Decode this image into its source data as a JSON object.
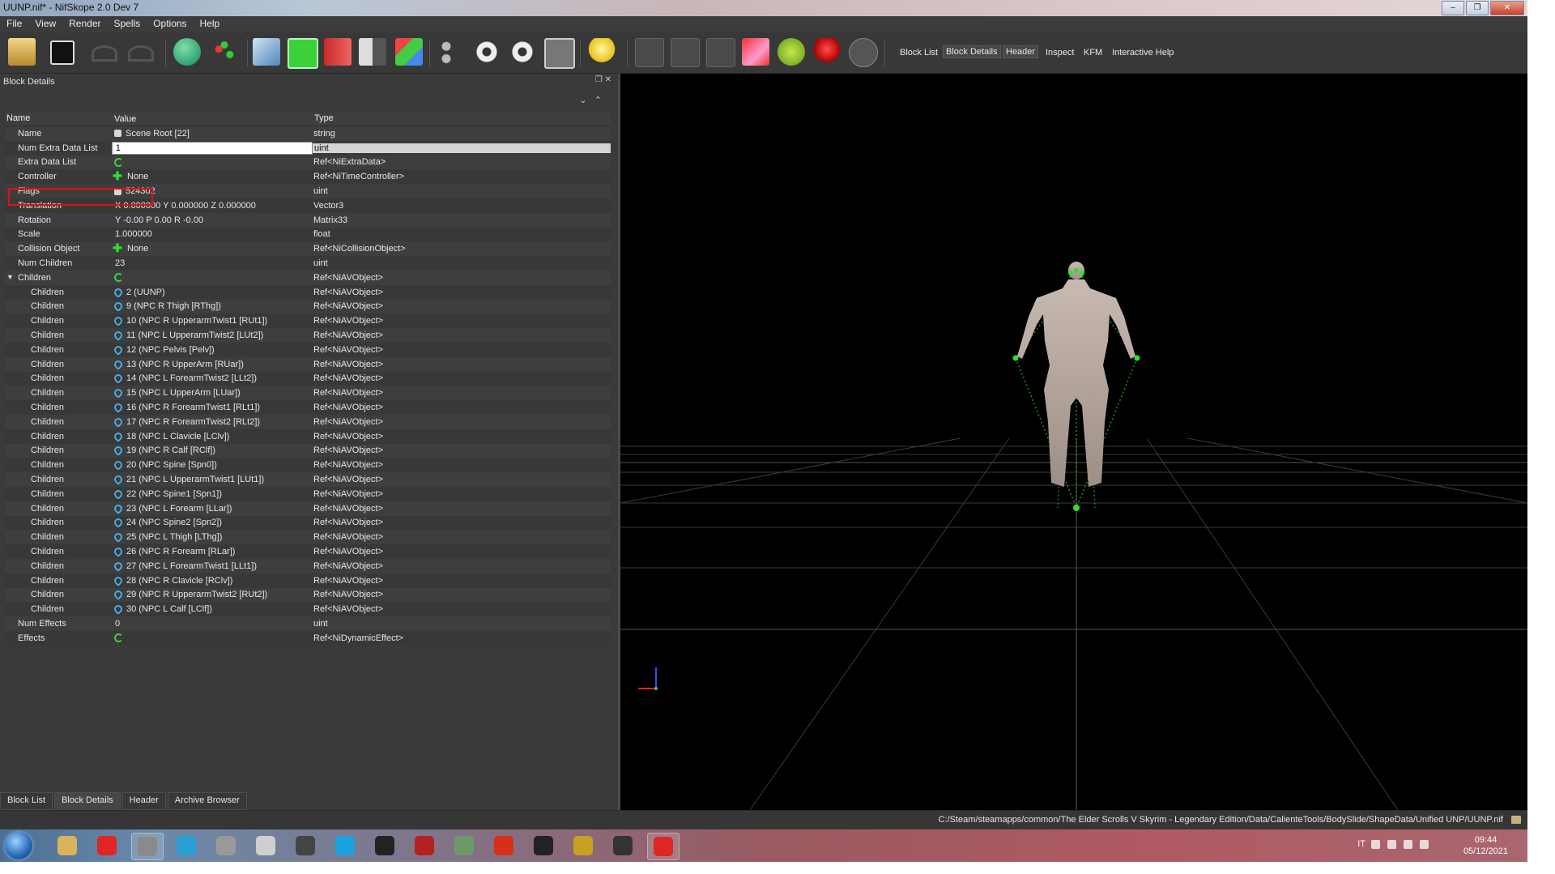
{
  "window": {
    "title": "UUNP.nif* - NifSkope 2.0 Dev 7",
    "controls": [
      "–",
      "❐",
      "✕"
    ]
  },
  "menu": [
    "File",
    "View",
    "Render",
    "Spells",
    "Options",
    "Help"
  ],
  "toolbar": {
    "icons": [
      "open-file-icon",
      "save-file-icon",
      "undo-icon",
      "redo-icon",
      "select-object-icon",
      "select-vertex-icon",
      "view-front-icon",
      "view-top-icon",
      "view-side-icon",
      "view-flip-icon",
      "view-perspective-icon",
      "walk-mode-icon",
      "show-hidden-icon",
      "show-nodes-icon",
      "screenshot-icon",
      "lighting-icon",
      "draw-axes-icon",
      "draw-nodes-icon",
      "draw-havok-icon",
      "draw-constraints-icon",
      "draw-markers-icon",
      "draw-furniture-icon",
      "hide-icon"
    ],
    "views": [
      {
        "label": "Block List",
        "active": false
      },
      {
        "label": "Block Details",
        "active": true
      },
      {
        "label": "Header",
        "active": true
      },
      {
        "label": "Inspect",
        "active": false
      },
      {
        "label": "KFM",
        "active": false
      },
      {
        "label": "Interactive Help",
        "active": false
      }
    ]
  },
  "panel": {
    "title": "Block Details",
    "columns": {
      "name": "Name",
      "value": "Value",
      "type": "Type"
    },
    "rows": [
      {
        "name": "Name",
        "value": "Scene Root [22]",
        "type": "string",
        "icon": "flag",
        "indent": 1
      },
      {
        "name": "Num Extra Data List",
        "value": "1",
        "type": "uint",
        "icon": "",
        "indent": 1,
        "selected": true
      },
      {
        "name": "Extra Data List",
        "value": "",
        "type": "Ref<NiExtraData>",
        "icon": "cycle",
        "indent": 1
      },
      {
        "name": "Controller",
        "value": "None",
        "type": "Ref<NiTimeController>",
        "icon": "plus",
        "indent": 1
      },
      {
        "name": "Flags",
        "value": "524302",
        "type": "uint",
        "icon": "flag",
        "indent": 1
      },
      {
        "name": "Translation",
        "value": "X 0.000000 Y 0.000000 Z 0.000000",
        "type": "Vector3",
        "icon": "",
        "indent": 1
      },
      {
        "name": "Rotation",
        "value": "Y -0.00 P 0.00 R -0.00",
        "type": "Matrix33",
        "icon": "",
        "indent": 1
      },
      {
        "name": "Scale",
        "value": "1.000000",
        "type": "float",
        "icon": "",
        "indent": 1
      },
      {
        "name": "Collision Object",
        "value": "None",
        "type": "Ref<NiCollisionObject>",
        "icon": "plus",
        "indent": 1
      },
      {
        "name": "Num Children",
        "value": "23",
        "type": "uint",
        "icon": "",
        "indent": 1
      },
      {
        "name": "Children",
        "value": "",
        "type": "Ref<NiAVObject>",
        "icon": "cycle",
        "indent": 1,
        "expanded": true
      },
      {
        "name": "Children",
        "value": "2 (UUNP)",
        "type": "Ref<NiAVObject>",
        "icon": "link",
        "indent": 2
      },
      {
        "name": "Children",
        "value": "9 (NPC R Thigh [RThg])",
        "type": "Ref<NiAVObject>",
        "icon": "link",
        "indent": 2
      },
      {
        "name": "Children",
        "value": "10 (NPC R UpperarmTwist1 [RUt1])",
        "type": "Ref<NiAVObject>",
        "icon": "link",
        "indent": 2
      },
      {
        "name": "Children",
        "value": "11 (NPC L UpperarmTwist2 [LUt2])",
        "type": "Ref<NiAVObject>",
        "icon": "link",
        "indent": 2
      },
      {
        "name": "Children",
        "value": "12 (NPC Pelvis [Pelv])",
        "type": "Ref<NiAVObject>",
        "icon": "link",
        "indent": 2
      },
      {
        "name": "Children",
        "value": "13 (NPC R UpperArm [RUar])",
        "type": "Ref<NiAVObject>",
        "icon": "link",
        "indent": 2
      },
      {
        "name": "Children",
        "value": "14 (NPC L ForearmTwist2 [LLt2])",
        "type": "Ref<NiAVObject>",
        "icon": "link",
        "indent": 2
      },
      {
        "name": "Children",
        "value": "15 (NPC L UpperArm [LUar])",
        "type": "Ref<NiAVObject>",
        "icon": "link",
        "indent": 2
      },
      {
        "name": "Children",
        "value": "16 (NPC R ForearmTwist1 [RLt1])",
        "type": "Ref<NiAVObject>",
        "icon": "link",
        "indent": 2
      },
      {
        "name": "Children",
        "value": "17 (NPC R ForearmTwist2 [RLt2])",
        "type": "Ref<NiAVObject>",
        "icon": "link",
        "indent": 2
      },
      {
        "name": "Children",
        "value": "18 (NPC L Clavicle [LClv])",
        "type": "Ref<NiAVObject>",
        "icon": "link",
        "indent": 2
      },
      {
        "name": "Children",
        "value": "19 (NPC R Calf [RClf])",
        "type": "Ref<NiAVObject>",
        "icon": "link",
        "indent": 2
      },
      {
        "name": "Children",
        "value": "20 (NPC Spine [Spn0])",
        "type": "Ref<NiAVObject>",
        "icon": "link",
        "indent": 2
      },
      {
        "name": "Children",
        "value": "21 (NPC L UpperarmTwist1 [LUt1])",
        "type": "Ref<NiAVObject>",
        "icon": "link",
        "indent": 2
      },
      {
        "name": "Children",
        "value": "22 (NPC Spine1 [Spn1])",
        "type": "Ref<NiAVObject>",
        "icon": "link",
        "indent": 2
      },
      {
        "name": "Children",
        "value": "23 (NPC L Forearm [LLar])",
        "type": "Ref<NiAVObject>",
        "icon": "link",
        "indent": 2
      },
      {
        "name": "Children",
        "value": "24 (NPC Spine2 [Spn2])",
        "type": "Ref<NiAVObject>",
        "icon": "link",
        "indent": 2
      },
      {
        "name": "Children",
        "value": "25 (NPC L Thigh [LThg])",
        "type": "Ref<NiAVObject>",
        "icon": "link",
        "indent": 2
      },
      {
        "name": "Children",
        "value": "26 (NPC R Forearm [RLar])",
        "type": "Ref<NiAVObject>",
        "icon": "link",
        "indent": 2
      },
      {
        "name": "Children",
        "value": "27 (NPC L ForearmTwist1 [LLt1])",
        "type": "Ref<NiAVObject>",
        "icon": "link",
        "indent": 2
      },
      {
        "name": "Children",
        "value": "28 (NPC R Clavicle [RClv])",
        "type": "Ref<NiAVObject>",
        "icon": "link",
        "indent": 2
      },
      {
        "name": "Children",
        "value": "29 (NPC R UpperarmTwist2 [RUt2])",
        "type": "Ref<NiAVObject>",
        "icon": "link",
        "indent": 2
      },
      {
        "name": "Children",
        "value": "30 (NPC L Calf [LClf])",
        "type": "Ref<NiAVObject>",
        "icon": "link",
        "indent": 2
      },
      {
        "name": "Num Effects",
        "value": "0",
        "type": "uint",
        "icon": "",
        "indent": 1
      },
      {
        "name": "Effects",
        "value": "",
        "type": "Ref<NiDynamicEffect>",
        "icon": "cycle",
        "indent": 1
      }
    ]
  },
  "bottom_tabs": [
    {
      "label": "Block List",
      "active": false
    },
    {
      "label": "Block Details",
      "active": true
    },
    {
      "label": "Header",
      "active": false
    },
    {
      "label": "Archive Browser",
      "active": false
    }
  ],
  "status": {
    "path": "C:/Steam/steamapps/common/The Elder Scrolls V Skyrim - Legendary Edition/Data/CalienteTools/BodySlide/ShapeData/Unified UNP/UUNP.nif"
  },
  "taskbar": {
    "apps": [
      "explorer-icon",
      "opera-icon",
      "nifskope-icon",
      "itunes-icon",
      "audio-icon",
      "ffdec-icon",
      "bar-icon",
      "skype-icon",
      "nmm-icon",
      "game-icon",
      "app-icon",
      "f-icon",
      "boot-icon",
      "chart-icon",
      "skyrim-icon",
      "opera-icon"
    ],
    "language": "IT",
    "time": "09:44",
    "date": "05/12/2021"
  },
  "colors": {
    "accent_red": "#e01010",
    "node_green": "#2ee02e",
    "panel_bg": "#3a3a3a"
  }
}
